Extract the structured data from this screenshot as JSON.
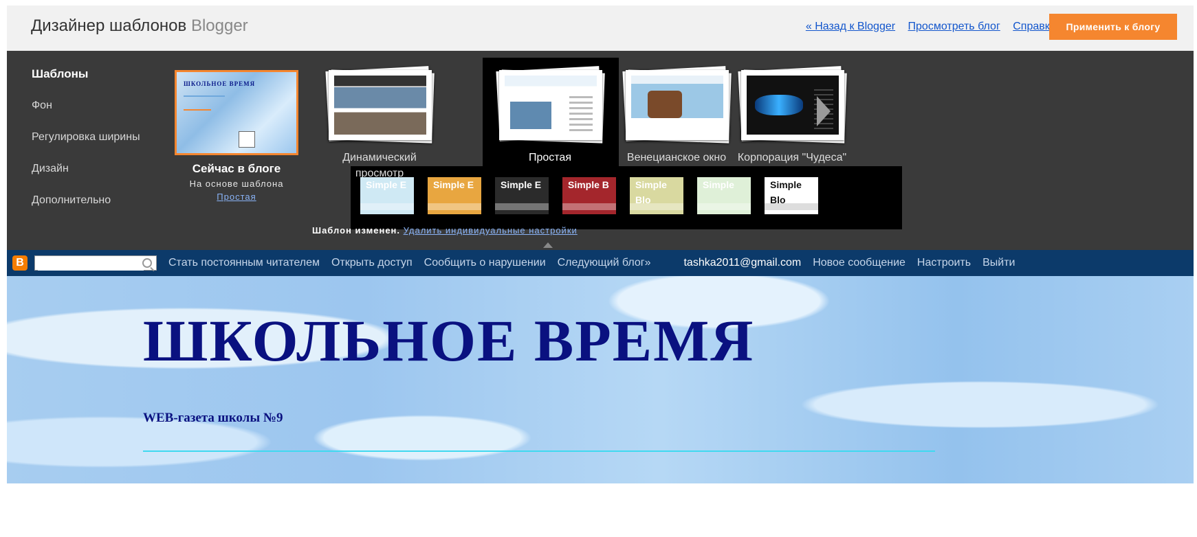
{
  "header": {
    "title_main": "Дизайнер шаблонов",
    "title_brand": "Blogger",
    "links": [
      "« Назад к Blogger",
      "Просмотреть блог",
      "Справка"
    ],
    "apply_button": "Применить к блогу"
  },
  "sidebar": {
    "items": [
      {
        "label": "Шаблоны",
        "active": true
      },
      {
        "label": "Фон",
        "active": false
      },
      {
        "label": "Регулировка ширины",
        "active": false
      },
      {
        "label": "Дизайн",
        "active": false
      },
      {
        "label": "Дополнительно",
        "active": false
      }
    ]
  },
  "current": {
    "thumb_title": "ШКОЛЬНОЕ ВРЕМЯ",
    "label": "Сейчас в блоге",
    "based_on": "На основе шаблона",
    "template_link": "Простая"
  },
  "templates": [
    {
      "name": "Динамический просмотр",
      "selected": false
    },
    {
      "name": "Простая",
      "selected": true
    },
    {
      "name": "Венецианское окно",
      "selected": false
    },
    {
      "name": "Корпорация \"Чудеса\"",
      "selected": false
    }
  ],
  "variants": [
    {
      "label": "Simple E",
      "bg": "#cfe9f4",
      "color": "#ffffff"
    },
    {
      "label": "Simple E",
      "bg": "#e8a640",
      "color": "#ffffff"
    },
    {
      "label": "Simple E",
      "bg": "#2b2b2b",
      "color": "#ffffff"
    },
    {
      "label": "Simple B",
      "bg": "#a4262c",
      "color": "#ffffff"
    },
    {
      "label": "Simple Blo",
      "bg": "#d9d9a0",
      "color": "#ffffff"
    },
    {
      "label": "Simple",
      "bg": "#dff0d8",
      "color": "#ffffff"
    },
    {
      "label": "Simple Blo",
      "bg": "#ffffff",
      "color": "#111111"
    }
  ],
  "status": {
    "text": "Шаблон изменен.",
    "link": "Удалить индивидуальные настройки"
  },
  "navbar": {
    "logo": "B",
    "search_placeholder": "",
    "links": [
      "Стать постоянным читателем",
      "Открыть доступ",
      "Сообщить о нарушении",
      "Следующий блог»"
    ],
    "user_email": "tashka2011@gmail.com",
    "user_links": [
      "Новое сообщение",
      "Настроить",
      "Выйти"
    ]
  },
  "blog": {
    "title": "ШКОЛЬНОЕ ВРЕМЯ",
    "description": "WEB-газета школы №9"
  },
  "colors": {
    "accent": "#f5862f",
    "panel": "#3a3a3a",
    "navbar": "#0c3a6a",
    "blog_title": "#0a1180",
    "link": "#1155cc"
  }
}
